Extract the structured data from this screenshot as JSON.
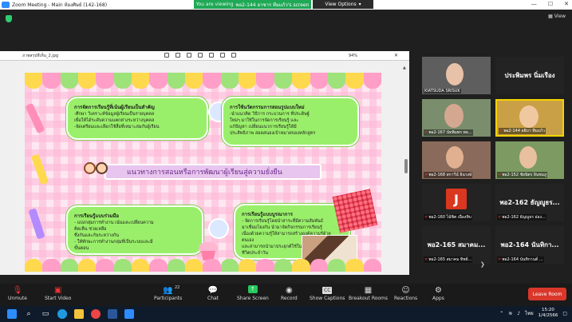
{
  "window": {
    "title": "Zoom Meeting - Main ห้องศิษย์ (142-168)",
    "minimize": "—",
    "maximize": "☐",
    "close": "✕"
  },
  "share_banner": {
    "viewing_label": "You are viewing",
    "viewing_name": "พอ2-144 อาชาร ทีมแก้ว's screen"
  },
  "view_options": {
    "label": "View Options",
    "caret": "▾"
  },
  "view_button": {
    "label": "View"
  },
  "shared_window": {
    "filename": "ภาพสรุปที่เห็น_2.jpg",
    "zoom": "94%",
    "close": "✕"
  },
  "slide": {
    "top_left_card": {
      "title": "การจัดการเรียนรู้ที่เน้นผู้เรียนเป็นสำคัญ",
      "lines": [
        "-ศึกษา วิเคราะห์ข้อมูลผู้เรียนเป็นรายบุคคล",
        "เพื่อให้ได้ระดับความแตกต่างระหว่างบุคคล",
        "-จัดเตรียมและเลือกใช้สื่อที่เหมาะสมกับผู้เรียน"
      ]
    },
    "top_right_card": {
      "title": "การใช้นวัตกรรมการสอนรูปแบบใหม่",
      "lines": [
        "-นำแนวคิด วิธีการ กระบวนการ ที่ประดิษฐ์",
        "ใหม่ๆ มาใช้ในการจัดการเรียนรู้ และ",
        "แก้ปัญหา เปลี่ยนแนวการเรียนรู้ให้มี",
        "ประสิทธิภาพ สอดสนองเป้าหมายของหลักสูตร"
      ]
    },
    "title_band": "แนวทางการสอนหรือการพัฒนาผู้เรียนสู่ความยั่งยืน",
    "bottom_left_card": {
      "title": "การเรียนรู้แบบร่วมมือ",
      "lines": [
        "- แบ่งกลุ่มการทำงาน เน้นและเปลี่ยนความ",
        "คิดเห็น ช่วยเหลือ",
        "  ซึ่งกันและกันระหว่างกัน",
        "- ให้ทักษะการทำงานกลุ่มที่เป็นระบบและมี",
        "ขั้นตอน"
      ]
    },
    "bottom_right_card": {
      "title": "การเรียนรู้แบบบูรณาการ",
      "lines": [
        "- จัดการเรียนรู้โดยนำสาระที่มีความสัมพันธ์",
        "มาเชื่อมโยงกัน นำมาจัดกิจกรรมการเรียนรู้",
        "เนื่องด้วยความรู้ให้สามารถสร้างองค์ความรู้ด้วยตนเอง",
        "และสามารถนำมาประยุกต์ใช้ใน",
        "ชีวิตประจำวัน"
      ]
    }
  },
  "gallery": {
    "tiles": [
      {
        "name": "KIATSUDA SRISUK",
        "big": "",
        "type": "video"
      },
      {
        "name": "",
        "big": "ประพิมพร นิ่มเรือง",
        "type": "name"
      },
      {
        "name": "พอ2-167 นัทพิมพร พจ...",
        "big": "",
        "type": "video"
      },
      {
        "name": "พอ2-144 อธิบา ทีมแก้ว",
        "big": "",
        "type": "video-active"
      },
      {
        "name": "พอ2-168 สกาวีน์ อินวงษ์",
        "big": "",
        "type": "video"
      },
      {
        "name": "พอ2-152 ชัยนิตร อินชมภู",
        "big": "",
        "type": "video"
      },
      {
        "name": "พอ2-160 ไฉ้ชิต เนืองทิบ",
        "big": "",
        "type": "avatar",
        "initial": "J"
      },
      {
        "name": "พอ2-162 ธัญญูธร อ่อง...",
        "big": "พอ2-162 ธัญญูธร...",
        "type": "name"
      },
      {
        "name": "พอ2-165 สมาคม ทิพย์...",
        "big": "พอ2-165 สมาคม...",
        "type": "name"
      },
      {
        "name": "พอ2-164 นันทิกานต์ ...",
        "big": "พอ2-164 นันทิกา...",
        "type": "name"
      }
    ],
    "nav": "❯"
  },
  "controls": {
    "unmute": "Unmute",
    "start_video": "Start Video",
    "participants": "Participants",
    "participants_count": "22",
    "chat": "Chat",
    "share_screen": "Share Screen",
    "record": "Record",
    "show_captions": "Show Captions",
    "breakout_rooms": "Breakout Rooms",
    "reactions": "Reactions",
    "apps": "Apps",
    "leave_room": "Leave Room",
    "cc": "CC"
  },
  "taskbar": {
    "time": "15:20",
    "date": "1/4/2566",
    "lang": "ไทย"
  },
  "colors": {
    "card_green": "#9aef6a",
    "share_green": "#1fa855",
    "leave_red": "#d9372a",
    "active_yellow": "#f5d300"
  }
}
